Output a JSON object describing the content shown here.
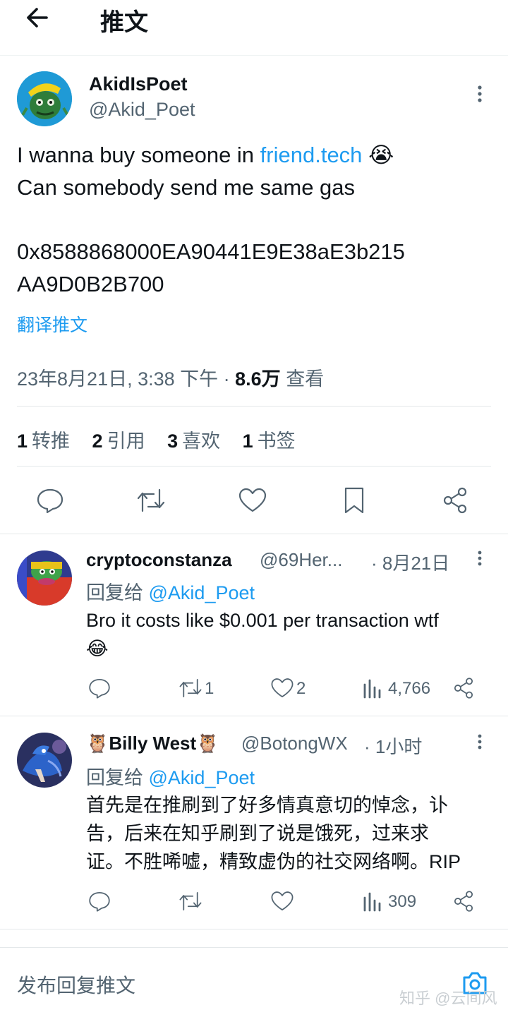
{
  "header": {
    "title": "推文"
  },
  "main_tweet": {
    "display_name": "AkidIsPoet",
    "handle": "@Akid_Poet",
    "text_line1_prefix": "I wanna buy someone in ",
    "link_text": "friend.tech",
    "emoji1": "😭",
    "text_line2": "Can somebody send me same gas",
    "address_line1": "0x8588868000EA90441E9E38aE3b215",
    "address_line2": "AA9D0B2B700",
    "translate_label": "翻译推文",
    "timestamp": "23年8月21日, 3:38 下午",
    "separator": " · ",
    "views_count": "8.6万",
    "views_label": "查看",
    "retweets_count": "1",
    "retweets_label": "转推",
    "quotes_count": "2",
    "quotes_label": "引用",
    "likes_count": "3",
    "likes_label": "喜欢",
    "bookmarks_count": "1",
    "bookmarks_label": "书签"
  },
  "replies": [
    {
      "display_name": "cryptoconstanza",
      "handle": "@69Her...",
      "time": "· 8月21日",
      "reply_to_prefix": "回复给 ",
      "reply_to_handle": "@Akid_Poet",
      "text": "Bro it costs like $0.001 per transaction wtf",
      "emoji": "😂",
      "retweets": "1",
      "likes": "2",
      "views": "4,766"
    },
    {
      "name_emoji_left": "🦉",
      "display_name": "Billy West",
      "name_emoji_right": "🦉",
      "handle": "@BotongWX",
      "time": "· 1小时",
      "reply_to_prefix": "回复给 ",
      "reply_to_handle": "@Akid_Poet",
      "text_line1": "首先是在推刷到了好多情真意切的悼念，讣",
      "text_line2": "告，后来在知乎刷到了说是饿死，过来求",
      "text_line3": "证。不胜唏嘘，精致虚伪的社交网络啊。RIP",
      "views": "309"
    }
  ],
  "footer": {
    "reply_placeholder": "发布回复推文",
    "watermark": "知乎 @云间风"
  },
  "colors": {
    "accent": "#1d9bf0",
    "text": "#0f1419",
    "secondary": "#536471",
    "divider": "#e4e8ea"
  }
}
